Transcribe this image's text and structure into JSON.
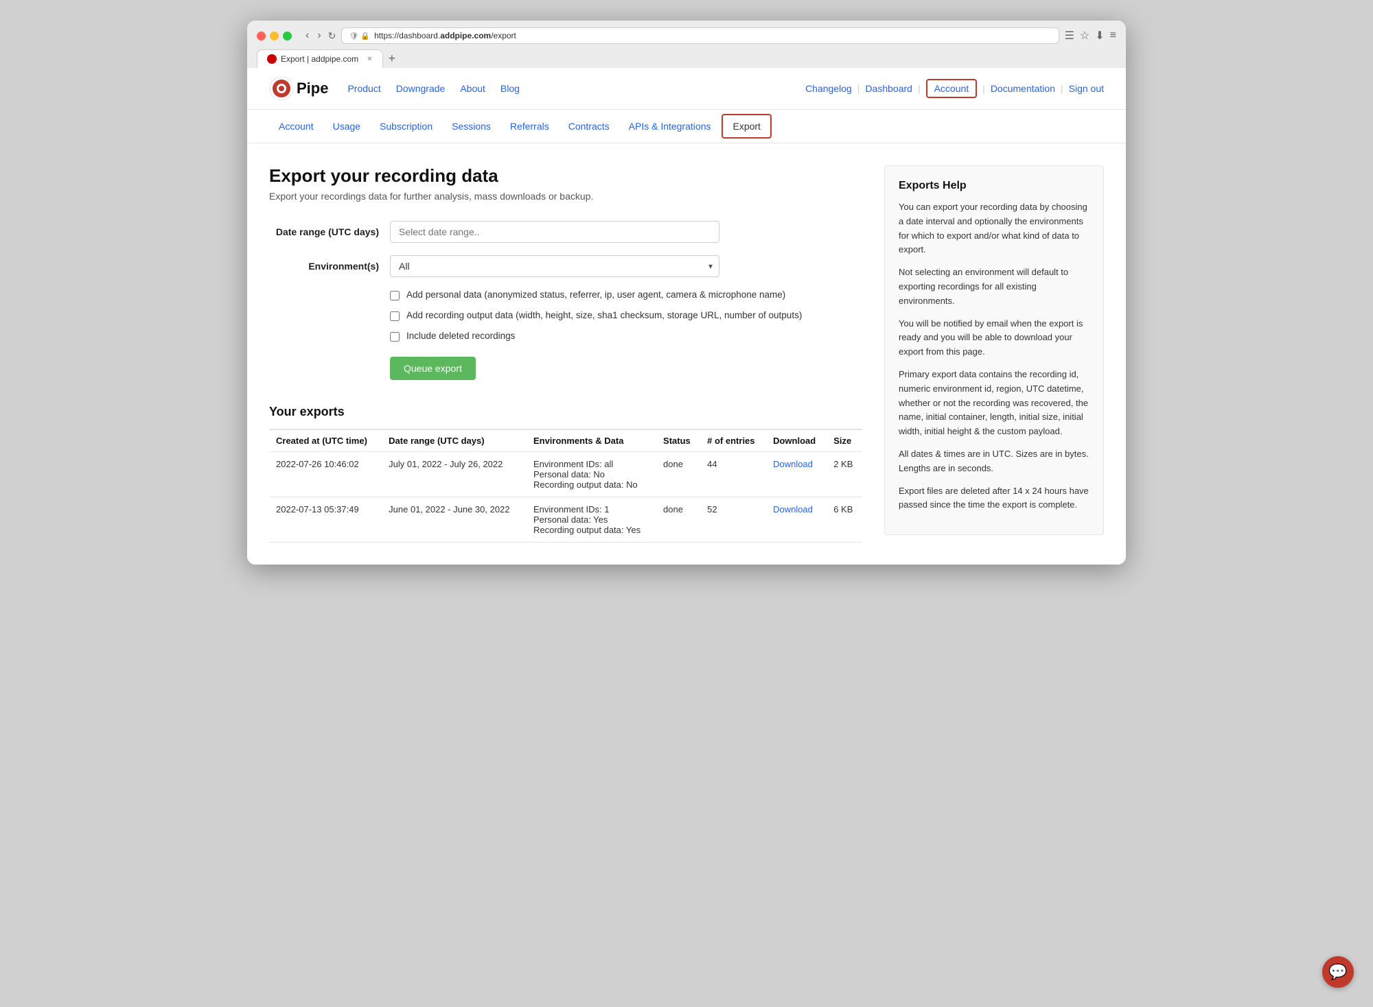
{
  "browser": {
    "url": "https://dashboard.addpipe.com/export",
    "url_pre": "https://dashboard.",
    "url_domain": "addpipe.com",
    "url_post": "/export",
    "tab_title": "Export | addpipe.com",
    "new_tab_label": "+"
  },
  "topnav": {
    "logo_text": "Pipe",
    "links": [
      {
        "label": "Product",
        "href": "#"
      },
      {
        "label": "Downgrade",
        "href": "#"
      },
      {
        "label": "About",
        "href": "#"
      },
      {
        "label": "Blog",
        "href": "#"
      }
    ],
    "right_links": [
      {
        "label": "Changelog"
      },
      {
        "label": "Dashboard"
      },
      {
        "label": "Account",
        "active": true
      },
      {
        "label": "Documentation"
      },
      {
        "label": "Sign out"
      }
    ]
  },
  "subnav": {
    "links": [
      {
        "label": "Account"
      },
      {
        "label": "Usage"
      },
      {
        "label": "Subscription"
      },
      {
        "label": "Sessions"
      },
      {
        "label": "Referrals"
      },
      {
        "label": "Contracts"
      },
      {
        "label": "APIs & Integrations"
      },
      {
        "label": "Export",
        "active": true
      }
    ]
  },
  "page": {
    "title": "Export your recording data",
    "subtitle": "Export your recordings data for further analysis, mass downloads or backup."
  },
  "form": {
    "date_range_label": "Date range (UTC days)",
    "date_range_placeholder": "Select date range..",
    "environments_label": "Environment(s)",
    "environments_value": "All",
    "checkbox1_label": "Add personal data (anonymized status, referrer, ip, user agent, camera & microphone name)",
    "checkbox2_label": "Add recording output data (width, height, size, sha1 checksum, storage URL, number of outputs)",
    "checkbox3_label": "Include deleted recordings",
    "queue_btn_label": "Queue export"
  },
  "exports": {
    "section_title": "Your exports",
    "columns": [
      {
        "label": "Created at (UTC time)"
      },
      {
        "label": "Date range (UTC days)"
      },
      {
        "label": "Environments & Data"
      },
      {
        "label": "Status"
      },
      {
        "label": "# of entries"
      },
      {
        "label": "Download"
      },
      {
        "label": "Size"
      }
    ],
    "rows": [
      {
        "created_at": "2022-07-26 10:46:02",
        "date_range": "July 01, 2022 - July 26, 2022",
        "environments": "Environment IDs: all\nPersonal data: No\nRecording output data: No",
        "status": "done",
        "entries": "44",
        "download_label": "Download",
        "size": "2 KB"
      },
      {
        "created_at": "2022-07-13 05:37:49",
        "date_range": "June 01, 2022 - June 30, 2022",
        "environments": "Environment IDs: 1\nPersonal data: Yes\nRecording output data: Yes",
        "status": "done",
        "entries": "52",
        "download_label": "Download",
        "size": "6 KB"
      }
    ]
  },
  "help": {
    "title": "Exports Help",
    "paragraphs": [
      "You can export your recording data by choosing a date interval and optionally the environments for which to export and/or what kind of data to export.",
      "Not selecting an environment will default to exporting recordings for all existing environments.",
      "You will be notified by email when the export is ready and you will be able to download your export from this page.",
      "Primary export data contains the recording id, numeric environment id, region, UTC datetime, whether or not the recording was recovered, the name, initial container, length, initial size, initial width, initial height & the custom payload.",
      "All dates & times are in UTC. Sizes are in bytes. Lengths are in seconds.",
      "Export files are deleted after 14 x 24 hours have passed since the time the export is complete."
    ]
  }
}
